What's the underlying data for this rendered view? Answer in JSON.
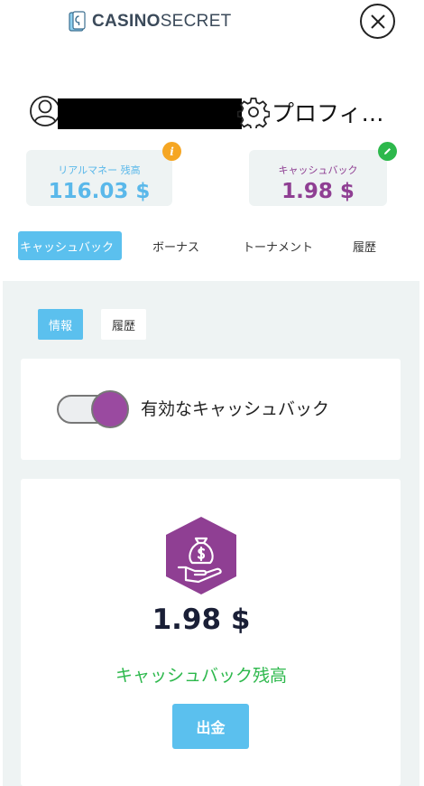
{
  "header": {
    "logo_bold": "CASINO",
    "logo_light": "SECRET",
    "logo_icon": "casino-card-icon",
    "close_icon": "close-circle-icon"
  },
  "profile": {
    "avatar_icon": "user-outline-icon",
    "settings_icon": "gear-icon",
    "settings_label": "プロフィ…"
  },
  "balances": {
    "real": {
      "label": "リアルマネー 残高",
      "value": "116.03 $",
      "badge_icon": "info-icon",
      "color": "#5ab8ea"
    },
    "cashback": {
      "label": "キャッシュバック",
      "value": "1.98 $",
      "badge_icon": "edit-pencil-icon",
      "color": "#8f3f93"
    }
  },
  "tabs": {
    "active": "キャッシュバック",
    "bonus": "ボーナス",
    "tournament": "トーナメント",
    "history": "履歴"
  },
  "subtabs": {
    "info": "情報",
    "history": "履歴"
  },
  "cashback_toggle": {
    "label": "有効なキャッシュバック",
    "enabled": true,
    "knob_color": "#9a4aa0"
  },
  "cashback_balance": {
    "icon": "money-bag-hand-icon",
    "amount": "1.98 $",
    "label": "キャッシュバック残高",
    "withdraw_label": "出金"
  },
  "colors": {
    "accent": "#5bc0ee",
    "purple": "#8f3f93",
    "green": "#2db84c",
    "orange": "#f5a623",
    "panel_bg": "#eef3f3"
  }
}
